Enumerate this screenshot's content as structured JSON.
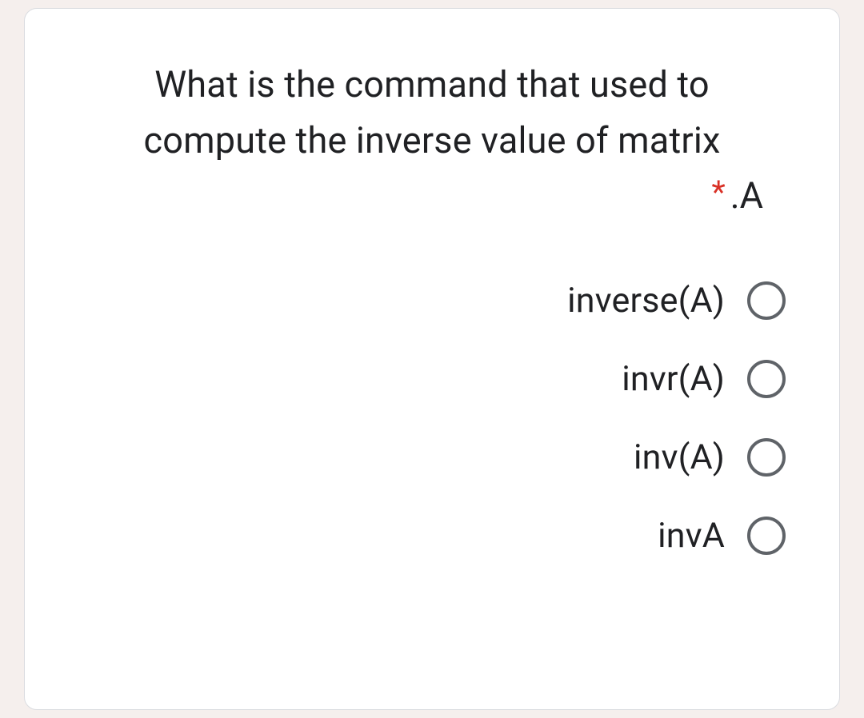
{
  "question": {
    "line1": "What is the command that used to",
    "line2": "compute the inverse value of matrix",
    "suffix": ".A",
    "required_marker": "*"
  },
  "options": [
    {
      "label": "inverse(A)"
    },
    {
      "label": "invr(A)"
    },
    {
      "label": "inv(A)"
    },
    {
      "label": "invA"
    }
  ]
}
